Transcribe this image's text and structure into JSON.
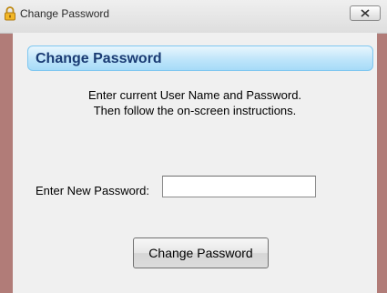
{
  "window": {
    "title": "Change Password",
    "app_icon": "padlock-icon",
    "close_icon": "close-icon"
  },
  "header": {
    "title": "Change Password"
  },
  "instructions": {
    "line1": "Enter current User Name and Password.",
    "line2": "Then follow the on-screen instructions."
  },
  "form": {
    "new_password_label": "Enter New Password:",
    "new_password_value": ""
  },
  "actions": {
    "change_password_label": "Change Password"
  },
  "colors": {
    "banner_text": "#1a3b73",
    "banner_background": "#bfe5fa",
    "client_background": "#f0f0f0",
    "frame": "#b17c78"
  }
}
